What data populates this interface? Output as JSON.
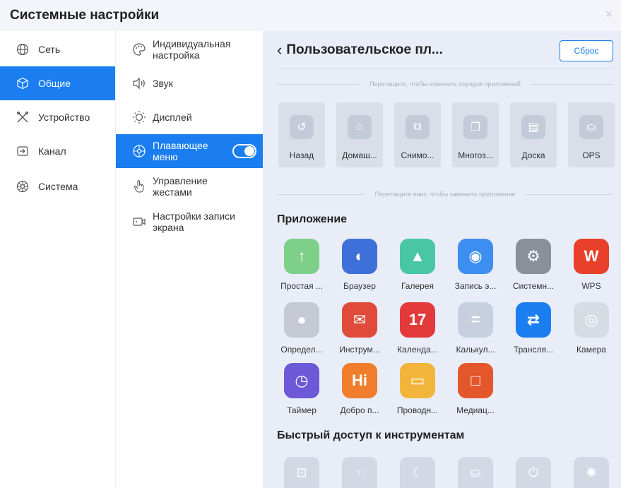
{
  "window": {
    "title": "Системные настройки",
    "close": "×"
  },
  "nav1": [
    {
      "label": "Сеть",
      "icon": "globe-icon",
      "active": false
    },
    {
      "label": "Общие",
      "icon": "cube-icon",
      "active": true
    },
    {
      "label": "Устройство",
      "icon": "tools-icon",
      "active": false
    },
    {
      "label": "Канал",
      "icon": "input-icon",
      "active": false
    },
    {
      "label": "Система",
      "icon": "flower-icon",
      "active": false
    }
  ],
  "nav2": [
    {
      "label": "Индивидуальная настройка",
      "icon": "palette-icon",
      "active": false
    },
    {
      "label": "Звук",
      "icon": "speaker-icon",
      "active": false
    },
    {
      "label": "Дисплей",
      "icon": "sun-icon",
      "active": false
    },
    {
      "label": "Плавающее меню",
      "icon": "float-menu-icon",
      "active": true,
      "toggle": true
    },
    {
      "label": "Управление жестами",
      "icon": "hand-icon",
      "active": false
    },
    {
      "label": "Настройки записи экрана",
      "icon": "record-icon",
      "active": false
    }
  ],
  "main": {
    "header": "Пользовательское пл...",
    "reset_label": "Сброс",
    "hint_top": "Перетащите, чтобы изменить порядок приложений",
    "hint_bottom": "Перетащите вниз, чтобы заменить приложение",
    "slots": [
      {
        "label": "Назад",
        "icon": "back-icon",
        "glyph": "↺"
      },
      {
        "label": "Домаш...",
        "icon": "home-icon",
        "glyph": "⌂"
      },
      {
        "label": "Снимо...",
        "icon": "crop-icon",
        "glyph": "⧉"
      },
      {
        "label": "Многоз...",
        "icon": "multitask-icon",
        "glyph": "❐"
      },
      {
        "label": "Доска",
        "icon": "board-icon",
        "glyph": "▤"
      },
      {
        "label": "OPS",
        "icon": "ops-icon",
        "glyph": "⛀"
      }
    ],
    "apps_title": "Приложение",
    "apps": [
      {
        "label": "Простая ...",
        "icon": "simple-app-icon",
        "glyph": "↑",
        "color": "#7ecf8a"
      },
      {
        "label": "Браузер",
        "icon": "browser-icon",
        "glyph": "◐",
        "color": "#3f6fd8"
      },
      {
        "label": "Галерея",
        "icon": "gallery-icon",
        "glyph": "▲",
        "color": "#49c6a4"
      },
      {
        "label": "Запись э...",
        "icon": "screen-record-icon",
        "glyph": "◉",
        "color": "#3d8ef0"
      },
      {
        "label": "Системн...",
        "icon": "system-settings-icon",
        "glyph": "⚙",
        "color": "#8a8f99"
      },
      {
        "label": "WPS",
        "icon": "wps-icon",
        "glyph": "W",
        "color": "#e8402b"
      },
      {
        "label": "Определ...",
        "icon": "detect-icon",
        "glyph": "●",
        "color": "#c4c9d4"
      },
      {
        "label": "Инструм...",
        "icon": "toolbox-icon",
        "glyph": "✉",
        "color": "#e04a3a"
      },
      {
        "label": "Календа...",
        "icon": "calendar-icon",
        "glyph": "17",
        "color": "#e23a3a"
      },
      {
        "label": "Калькул...",
        "icon": "calculator-icon",
        "glyph": "=",
        "color": "#c8d0e0"
      },
      {
        "label": "Трансля...",
        "icon": "cast-icon",
        "glyph": "⇄",
        "color": "#1a7ef0"
      },
      {
        "label": "Камера",
        "icon": "camera-icon",
        "glyph": "◎",
        "color": "#d7dbe3"
      },
      {
        "label": "Таймер",
        "icon": "timer-icon",
        "glyph": "◷",
        "color": "#6d58d8"
      },
      {
        "label": "Добро п...",
        "icon": "welcome-icon",
        "glyph": "Hi",
        "color": "#ef7d2b"
      },
      {
        "label": "Проводн...",
        "icon": "file-manager-icon",
        "glyph": "▭",
        "color": "#f2b43a"
      },
      {
        "label": "Медиац...",
        "icon": "media-icon",
        "glyph": "□",
        "color": "#e4572a"
      }
    ],
    "tools_title": "Быстрый доступ к инструментам",
    "tools": [
      {
        "icon": "lock-tool-icon",
        "glyph": "⊡"
      },
      {
        "icon": "touch-tool-icon",
        "glyph": "☜"
      },
      {
        "icon": "eye-care-tool-icon",
        "glyph": "☾"
      },
      {
        "icon": "ops-tool-icon",
        "glyph": "⛀"
      },
      {
        "icon": "power-tool-icon",
        "glyph": "⏻"
      },
      {
        "icon": "more-tool-icon",
        "glyph": "✺"
      }
    ]
  }
}
